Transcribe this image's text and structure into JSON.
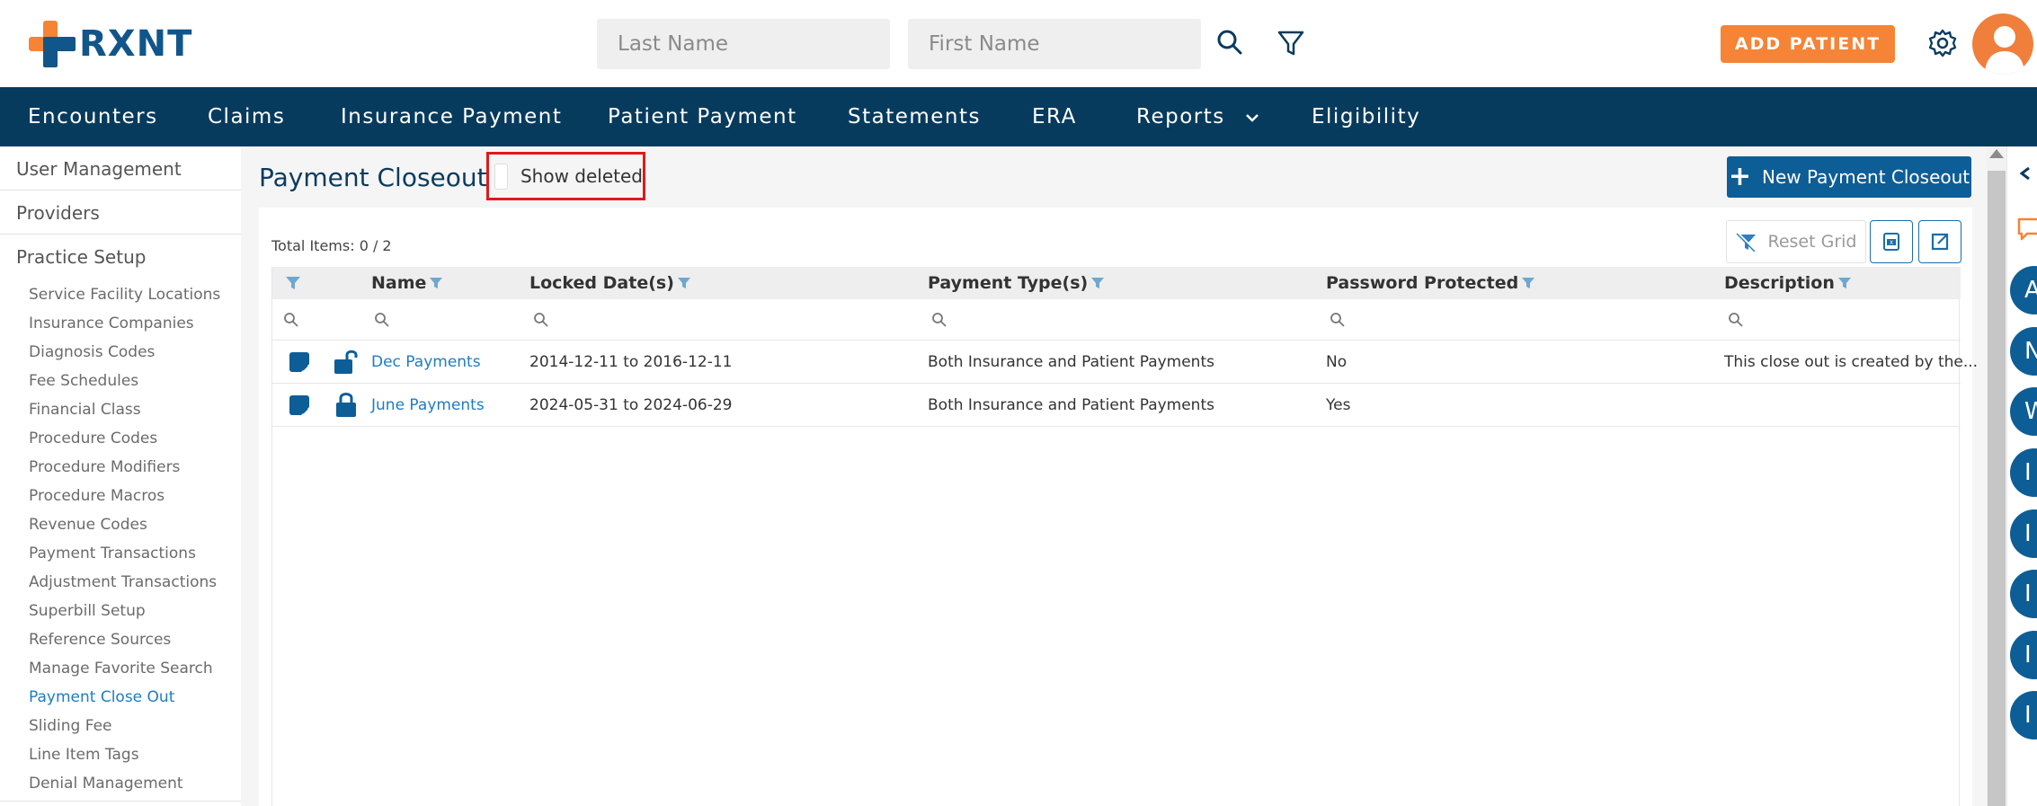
{
  "brand": {
    "name": "RXNT",
    "accent": "#f58436",
    "primary": "#073b5e",
    "link": "#1e7cc0",
    "highlight_border": "#e0191a"
  },
  "header": {
    "last_name_placeholder": "Last Name",
    "first_name_placeholder": "First Name",
    "search_icon": "search-icon",
    "filter_icon": "filter-icon",
    "add_patient_label": "ADD PATIENT",
    "settings_icon": "gear-icon",
    "avatar_icon": "user-avatar-icon"
  },
  "nav": {
    "items": [
      "Encounters",
      "Claims",
      "Insurance Payment",
      "Patient Payment",
      "Statements",
      "ERA",
      "Reports",
      "Eligibility"
    ],
    "reports_dropdown_icon": "chevron-down-icon"
  },
  "sidebar": {
    "sections": [
      "User Management",
      "Providers",
      "Practice Setup"
    ],
    "items": [
      "Service Facility Locations",
      "Insurance Companies",
      "Diagnosis Codes",
      "Fee Schedules",
      "Financial Class",
      "Procedure Codes",
      "Procedure Modifiers",
      "Procedure Macros",
      "Revenue Codes",
      "Payment Transactions",
      "Adjustment Transactions",
      "Superbill Setup",
      "Reference Sources",
      "Manage Favorite Search",
      "Payment Close Out",
      "Sliding Fee",
      "Line Item Tags",
      "Denial Management"
    ],
    "active_item": "Payment Close Out"
  },
  "main": {
    "title": "Payment Closeout",
    "show_deleted_label": "Show deleted",
    "show_deleted_checked": false,
    "new_button_label": "New Payment Closeout",
    "total_items": "Total Items: 0 / 2",
    "reset_grid_label": "Reset Grid",
    "export_excel_icon": "excel-export-icon",
    "export_icon": "export-icon"
  },
  "grid": {
    "columns": [
      "Name",
      "Locked Date(s)",
      "Payment Type(s)",
      "Password Protected",
      "Description"
    ],
    "rows": [
      {
        "name": "Dec Payments",
        "locked_dates": "2014-12-11 to 2016-12-11",
        "payment_types": "Both Insurance and Patient Payments",
        "password_protected": "No",
        "description": "This close out is created by the...",
        "lock_state": "unlocked-icon"
      },
      {
        "name": "June Payments",
        "locked_dates": "2024-05-31 to 2024-06-29",
        "payment_types": "Both Insurance and Patient Payments",
        "password_protected": "Yes",
        "description": "",
        "lock_state": "locked-icon"
      }
    ]
  },
  "rail": {
    "letters": [
      "A",
      "N",
      "W",
      "I",
      "I",
      "I",
      "I",
      "I"
    ]
  }
}
